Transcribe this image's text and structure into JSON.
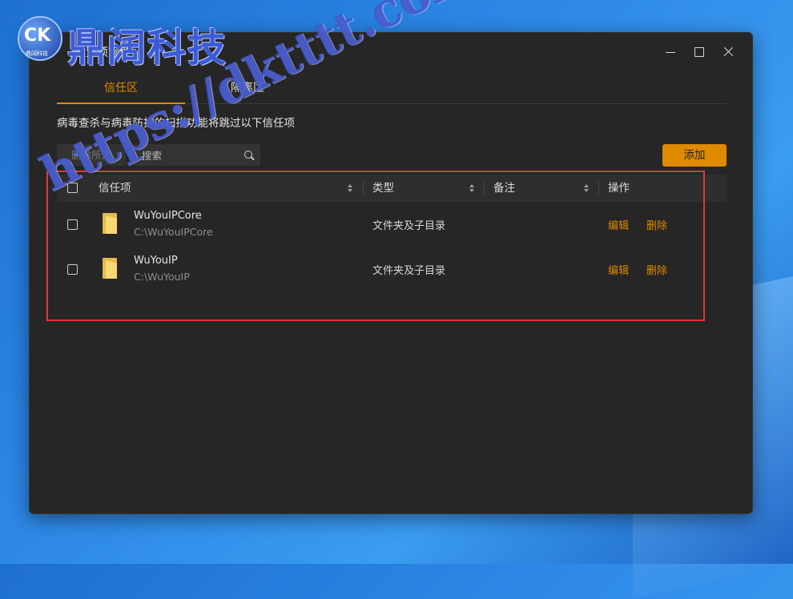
{
  "window": {
    "title": "设置项管理",
    "controls": {
      "minimize": "minimize-icon",
      "maximize": "maximize-icon",
      "close": "close-icon"
    }
  },
  "tabs": [
    {
      "label": "信任区",
      "active": true
    },
    {
      "label": "隔离区",
      "active": false
    }
  ],
  "description": "病毒查杀与病毒防护的扫描功能将跳过以下信任项",
  "toolbar": {
    "delete_selected_label": "删除所选",
    "search_placeholder": "搜索",
    "add_label": "添加"
  },
  "table": {
    "columns": [
      "信任项",
      "类型",
      "备注",
      "操作"
    ],
    "rows": [
      {
        "name": "WuYouIPCore",
        "path": "C:\\WuYouIPCore",
        "type": "文件夹及子目录",
        "note": "",
        "edit": "编辑",
        "delete": "删除"
      },
      {
        "name": "WuYouIP",
        "path": "C:\\WuYouIP",
        "type": "文件夹及子目录",
        "note": "",
        "edit": "编辑",
        "delete": "删除"
      }
    ]
  },
  "colors": {
    "accent": "#e08a00",
    "window_bg": "#262626",
    "highlight": "#e0383a"
  },
  "watermark": {
    "brand": "鼎阔科技",
    "logo_small": "鼎阔科技",
    "logo_mark": "CK",
    "url": "https://dktttt.com"
  }
}
